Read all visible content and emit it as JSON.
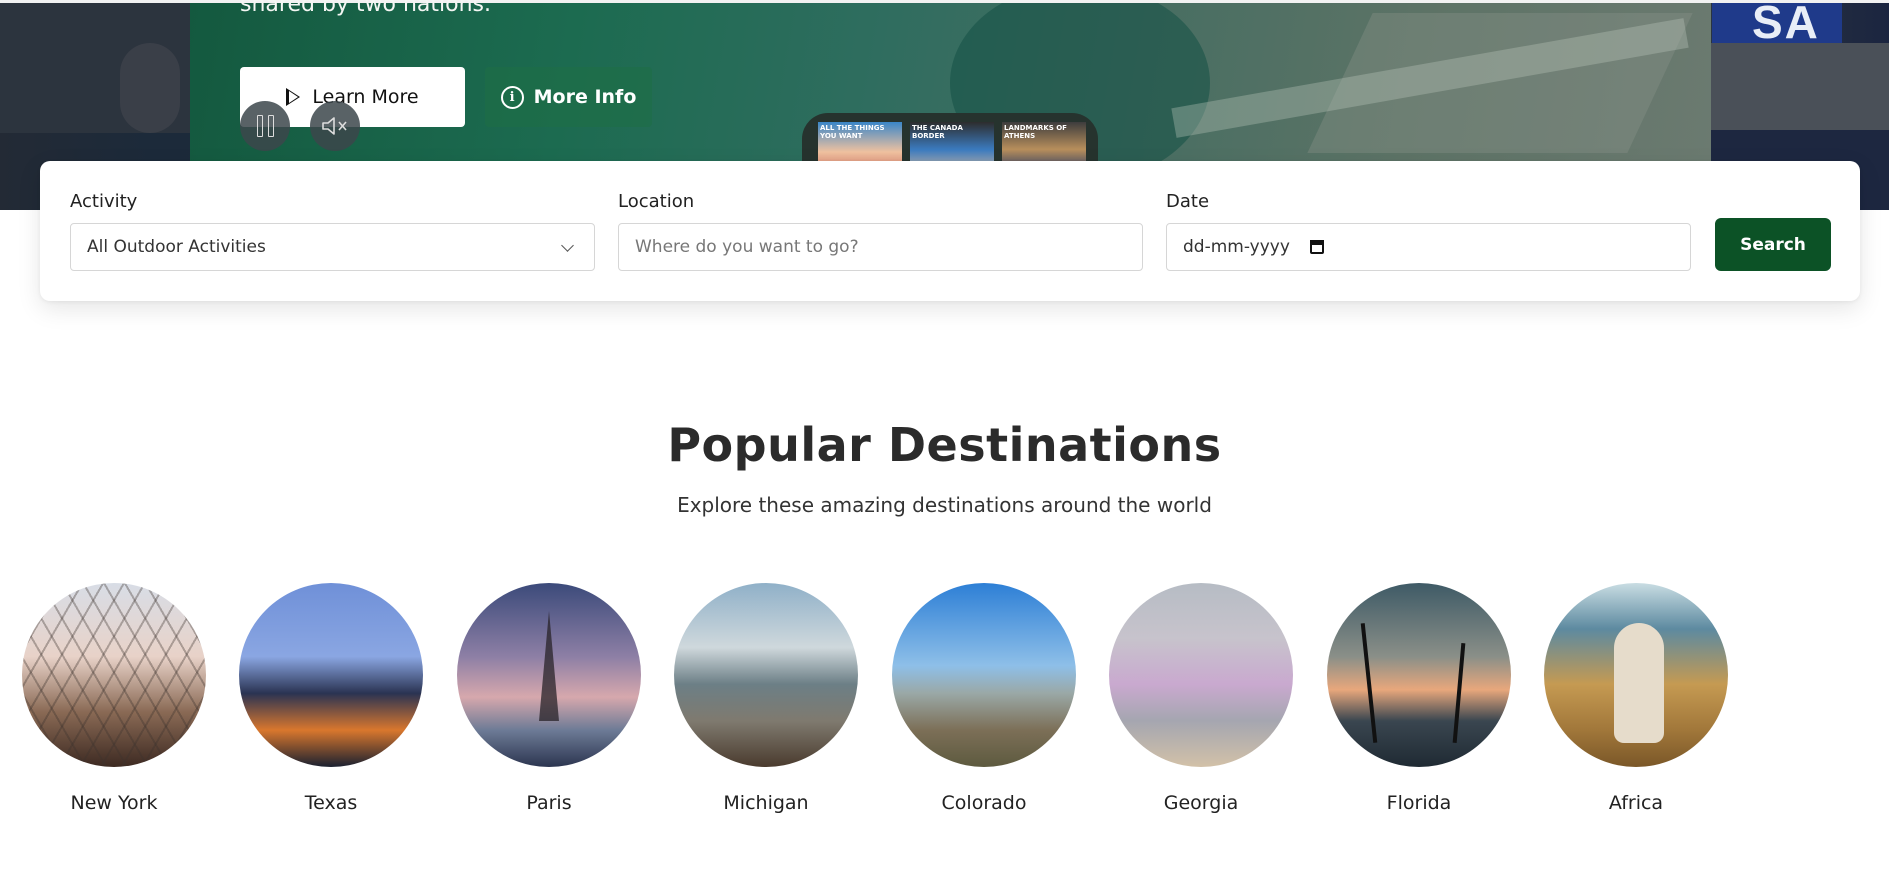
{
  "hero": {
    "text_line": "shared by two nations.",
    "learn_more_label": "Learn More",
    "more_info_label": "More Info",
    "sign_text": "SA",
    "thumbnails": [
      {
        "caption": "ALL THE THINGS YOU WANT"
      },
      {
        "caption": "THE CANADA BORDER"
      },
      {
        "caption": "LANDMARKS OF ATHENS"
      }
    ]
  },
  "search": {
    "activity_label": "Activity",
    "activity_value": "All Outdoor Activities",
    "location_label": "Location",
    "location_placeholder": "Where do you want to go?",
    "date_label": "Date",
    "date_placeholder": "dd-mm-yyyy",
    "search_button": "Search"
  },
  "popular": {
    "title": "Popular Destinations",
    "subtitle": "Explore these amazing destinations around the world",
    "destinations": [
      {
        "name": "New York"
      },
      {
        "name": "Texas"
      },
      {
        "name": "Paris"
      },
      {
        "name": "Michigan"
      },
      {
        "name": "Colorado"
      },
      {
        "name": "Georgia"
      },
      {
        "name": "Florida"
      },
      {
        "name": "Africa"
      }
    ]
  },
  "colors": {
    "primary_green": "#0c5226",
    "heading": "#2b2b2b"
  }
}
